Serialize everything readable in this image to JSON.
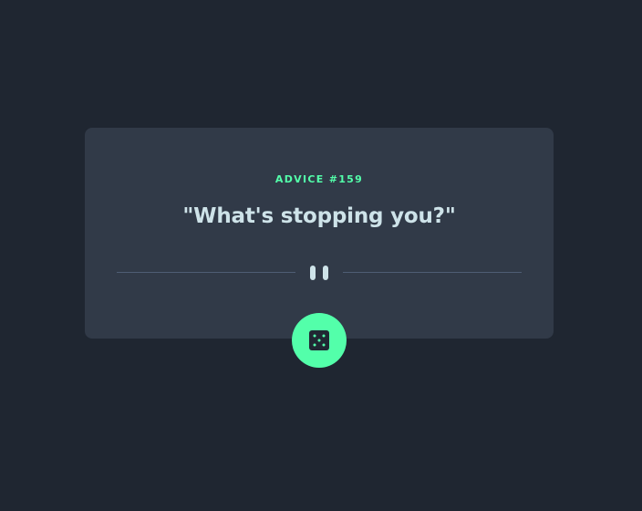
{
  "advice": {
    "label": "ADVICE #159",
    "quote": "\"What's stopping you?\""
  },
  "icons": {
    "divider": "pause-icon",
    "button": "dice-icon"
  },
  "colors": {
    "background": "#1f2631",
    "card": "#313a48",
    "accent": "#53ffaa",
    "text": "#cee3e9",
    "divider": "#4f5d74"
  }
}
